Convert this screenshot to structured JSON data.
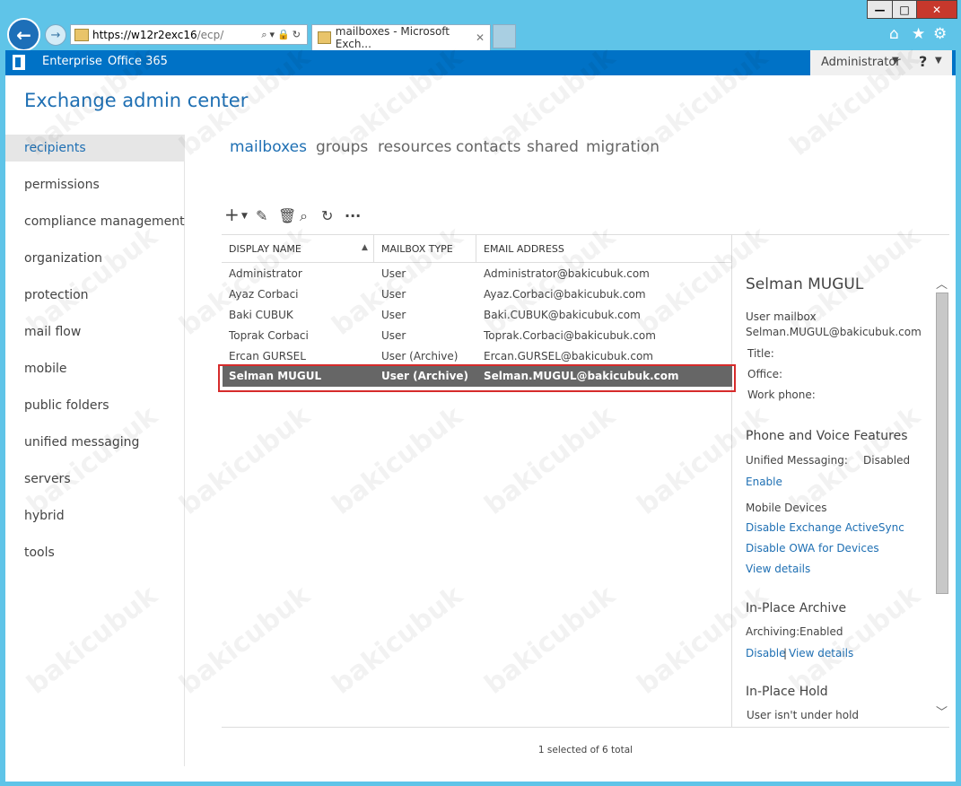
{
  "browser": {
    "address_bar": {
      "proto": "https://",
      "host": "w12r2exc16",
      "path": "/ecp/"
    },
    "tab_title": "mailboxes - Microsoft Exch...",
    "tab_close": "✕",
    "window_buttons": {
      "minimize": "—",
      "maximize": "□",
      "close": "✕"
    }
  },
  "topbar": {
    "nav": [
      "Enterprise",
      "Office 365"
    ],
    "user": "Administrator",
    "help": "?"
  },
  "app_title": "Exchange admin center",
  "leftnav": {
    "items": [
      {
        "label": "recipients",
        "active": true
      },
      {
        "label": "permissions"
      },
      {
        "label": "compliance management"
      },
      {
        "label": "organization"
      },
      {
        "label": "protection"
      },
      {
        "label": "mail flow"
      },
      {
        "label": "mobile"
      },
      {
        "label": "public folders"
      },
      {
        "label": "unified messaging"
      },
      {
        "label": "servers"
      },
      {
        "label": "hybrid"
      },
      {
        "label": "tools"
      }
    ]
  },
  "tabs": [
    {
      "label": "mailboxes",
      "active": true
    },
    {
      "label": "groups"
    },
    {
      "label": "resources"
    },
    {
      "label": "contacts"
    },
    {
      "label": "shared"
    },
    {
      "label": "migration"
    }
  ],
  "toolbar": {
    "icons": [
      "add-icon",
      "edit-icon",
      "delete-icon",
      "search-icon",
      "refresh-icon",
      "more-icon"
    ]
  },
  "table": {
    "columns": [
      "DISPLAY NAME",
      "MAILBOX TYPE",
      "EMAIL ADDRESS"
    ],
    "rows": [
      {
        "name": "Administrator",
        "type": "User",
        "email": "Administrator@bakicubuk.com"
      },
      {
        "name": "Ayaz Corbaci",
        "type": "User",
        "email": "Ayaz.Corbaci@bakicubuk.com"
      },
      {
        "name": "Baki CUBUK",
        "type": "User",
        "email": "Baki.CUBUK@bakicubuk.com"
      },
      {
        "name": "Toprak Corbaci",
        "type": "User",
        "email": "Toprak.Corbaci@bakicubuk.com"
      },
      {
        "name": "Ercan GURSEL",
        "type": "User (Archive)",
        "email": "Ercan.GURSEL@bakicubuk.com"
      },
      {
        "name": "Selman MUGUL",
        "type": "User (Archive)",
        "email": "Selman.MUGUL@bakicubuk.com",
        "selected": true
      }
    ],
    "status": "1 selected of 6 total"
  },
  "details": {
    "name": "Selman MUGUL",
    "type": "User mailbox",
    "email": "Selman.MUGUL@bakicubuk.com",
    "title_label": "Title:",
    "office_label": "Office:",
    "workphone_label": "Work phone:",
    "phone_voice_header": "Phone and Voice Features",
    "um_label": "Unified Messaging:",
    "um_value": "Disabled",
    "um_enable": "Enable",
    "mobile_header": "Mobile Devices",
    "disable_activesync": "Disable Exchange ActiveSync",
    "disable_owa": "Disable OWA for Devices",
    "view_details": "View details",
    "archive_header": "In-Place Archive",
    "archiving_label": "Archiving:",
    "archiving_value": "Enabled",
    "archive_disable": "Disable",
    "separator": "|",
    "archive_view_details": "View details",
    "hold_header": "In-Place Hold",
    "hold_status": "User isn't under hold"
  },
  "watermark": "bakicubuk"
}
